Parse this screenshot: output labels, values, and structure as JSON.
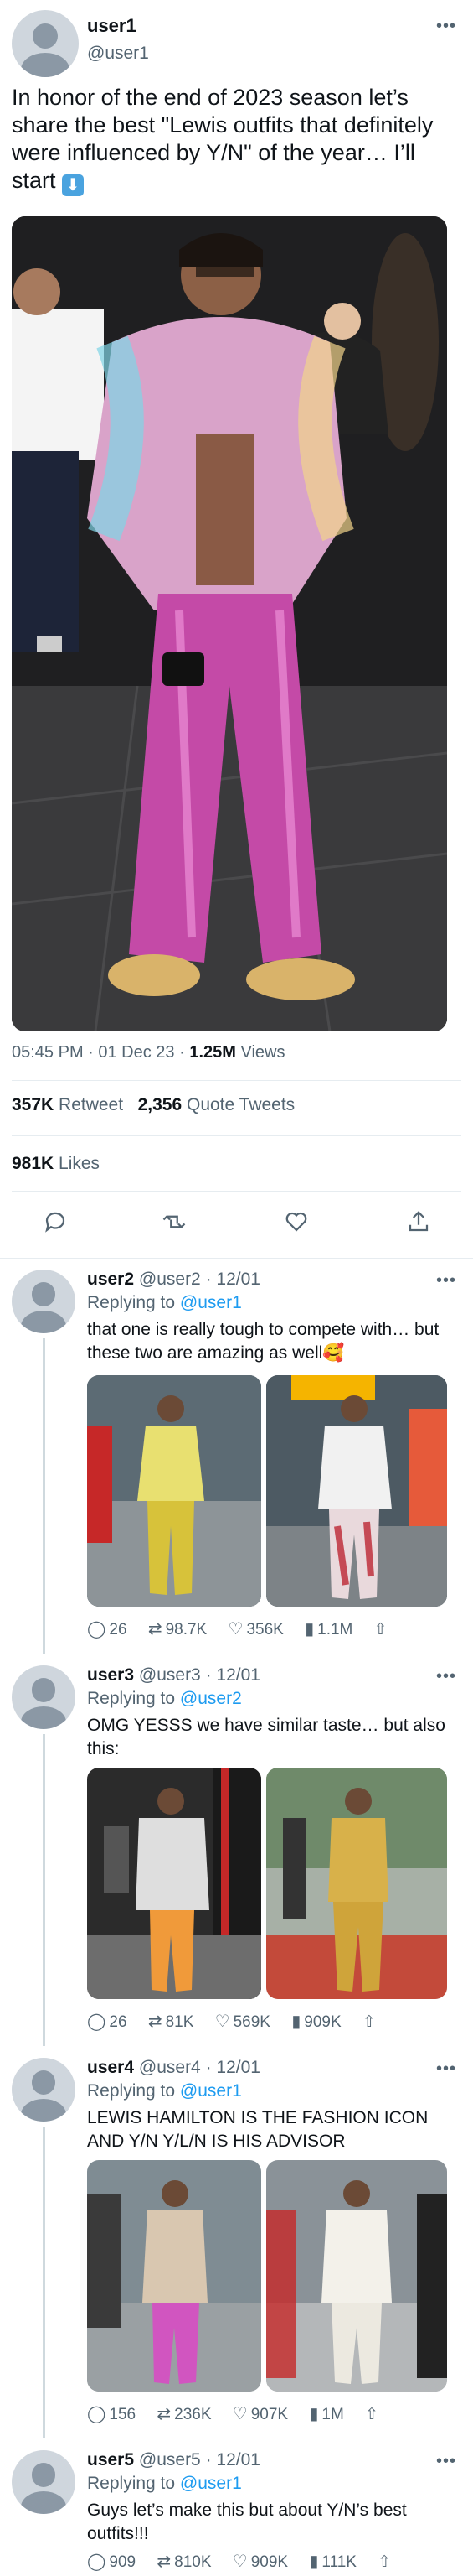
{
  "main_tweet": {
    "name": "user1",
    "handle": "@user1",
    "text": "In honor of the end of 2023 season let’s share the best \"Lewis outfits that definitely were influenced by Y/N\" of the year… I’ll start",
    "text_emoji": "⬇",
    "time": "05:45 PM · 01 Dec 23 · ",
    "views_count": "1.25M",
    "views_label": " Views",
    "retweets_count": "357K",
    "retweets_label": " Retweet",
    "quotes_count": "2,356",
    "quotes_label": " Quote Tweets",
    "likes_count": "981K",
    "likes_label": " Likes"
  },
  "replies": [
    {
      "name": "user2",
      "handle": "@user2",
      "date": "12/01",
      "replying_label": "Replying to ",
      "replying_to": "@user1",
      "text": "that one is really tough to compete with… but these two are amazing as well🥰",
      "replies": "26",
      "retweets": "98.7K",
      "likes": "356K",
      "views": "1.1M"
    },
    {
      "name": "user3",
      "handle": "@user3",
      "date": "12/01",
      "replying_label": "Replying to ",
      "replying_to": "@user2",
      "text": "OMG YESSS we have similar taste… but also this:",
      "replies": "26",
      "retweets": "81K",
      "likes": "569K",
      "views": "909K"
    },
    {
      "name": "user4",
      "handle": "@user4",
      "date": "12/01",
      "replying_label": "Replying to ",
      "replying_to": "@user1",
      "text": "LEWIS HAMILTON IS THE FASHION ICON AND Y/N Y/L/N IS HIS ADVISOR",
      "replies": "156",
      "retweets": "236K",
      "likes": "907K",
      "views": "1M"
    },
    {
      "name": "user5",
      "handle": "@user5",
      "date": "12/01",
      "replying_label": "Replying to ",
      "replying_to": "@user1",
      "text": "Guys let’s make this but about Y/N’s best outfits!!!",
      "replies": "909",
      "retweets": "810K",
      "likes": "909K",
      "views": "111K"
    }
  ],
  "colors": {
    "accent": "#1d9bf0",
    "secondary_text": "#536471",
    "divider": "#e6ecf0"
  },
  "icons": [
    "more-icon",
    "reply-icon",
    "retweet-icon",
    "like-icon",
    "share-icon",
    "views-icon",
    "arrow-down-emoji"
  ]
}
